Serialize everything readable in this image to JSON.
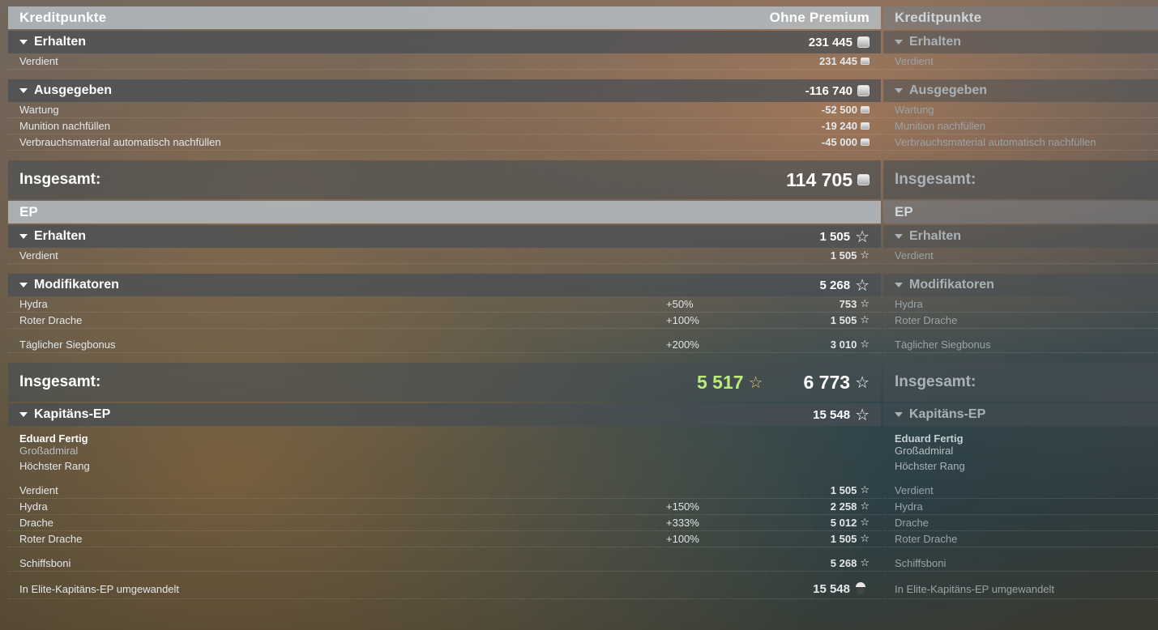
{
  "credits": {
    "title": "Kreditpunkte",
    "column_label": "Ohne Premium",
    "earned": {
      "label": "Erhalten",
      "value": "231 445",
      "rows": [
        {
          "label": "Verdient",
          "value": "231 445"
        }
      ]
    },
    "spent": {
      "label": "Ausgegeben",
      "value": "-116 740",
      "rows": [
        {
          "label": "Wartung",
          "value": "-52 500"
        },
        {
          "label": "Munition nachfüllen",
          "value": "-19 240"
        },
        {
          "label": "Verbrauchsmaterial automatisch nachfüllen",
          "value": "-45 000"
        }
      ]
    },
    "total": {
      "label": "Insgesamt:",
      "value": "114 705"
    }
  },
  "xp": {
    "title": "EP",
    "earned": {
      "label": "Erhalten",
      "value": "1 505",
      "rows": [
        {
          "label": "Verdient",
          "value": "1 505"
        }
      ]
    },
    "modifiers": {
      "label": "Modifikatoren",
      "value": "5 268",
      "rows": [
        {
          "label": "Hydra",
          "pct": "+50%",
          "value": "753"
        },
        {
          "label": "Roter Drache",
          "pct": "+100%",
          "value": "1 505"
        },
        {
          "label": "Täglicher Siegbonus",
          "pct": "+200%",
          "value": "3 010"
        }
      ]
    },
    "total": {
      "label": "Insgesamt:",
      "value_highlight": "5 517",
      "value": "6 773"
    }
  },
  "captain": {
    "label": "Kapitäns-EP",
    "value": "15 548",
    "name": "Eduard Fertig",
    "rank": "Großadmiral",
    "top_rank": "Höchster Rang",
    "rows": [
      {
        "label": "Verdient",
        "pct": "",
        "value": "1 505"
      },
      {
        "label": "Hydra",
        "pct": "+150%",
        "value": "2 258"
      },
      {
        "label": "Drache",
        "pct": "+333%",
        "value": "5 012"
      },
      {
        "label": "Roter Drache",
        "pct": "+100%",
        "value": "1 505"
      }
    ],
    "ship_bonus": {
      "label": "Schiffsboni",
      "value": "5 268"
    },
    "converted": {
      "label": "In Elite-Kapitäns-EP umgewandelt",
      "value": "15 548"
    }
  },
  "icons": {
    "credit": "credit-coin-icon",
    "xp": "star-icon",
    "elite": "elite-captain-icon"
  },
  "colors": {
    "highlight": "#b9ec7a",
    "star_gold": "#e3c15a"
  }
}
